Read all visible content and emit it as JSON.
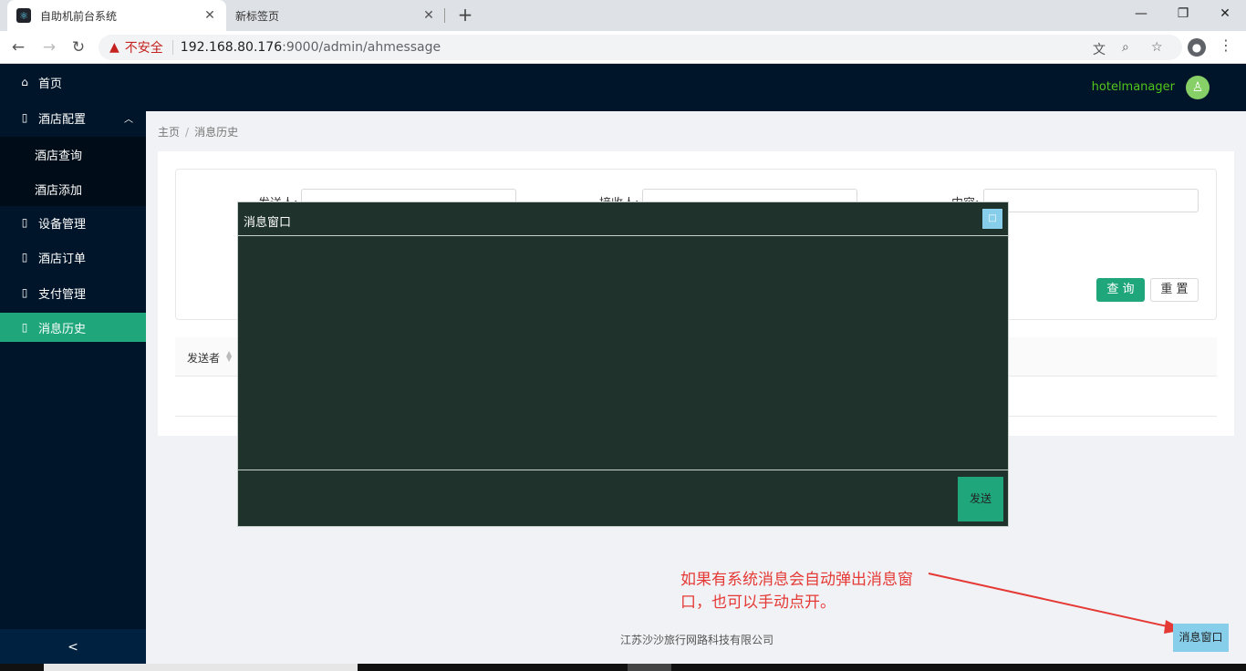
{
  "browser": {
    "tabs": [
      {
        "title": "自助机前台系统",
        "favicon": "react-logo-icon"
      },
      {
        "title": "新标签页"
      }
    ],
    "address": {
      "security_label": "不安全",
      "host": "192.168.80.176",
      "rest": ":9000/admin/ahmessage"
    }
  },
  "sidebar": {
    "items": [
      {
        "label": "首页",
        "icon": "home-icon"
      },
      {
        "label": "酒店配置",
        "icon": "file-icon"
      },
      {
        "label": "酒店查询"
      },
      {
        "label": "酒店添加"
      },
      {
        "label": "设备管理",
        "icon": "file-icon"
      },
      {
        "label": "酒店订单",
        "icon": "file-icon"
      },
      {
        "label": "支付管理",
        "icon": "file-icon"
      },
      {
        "label": "消息历史",
        "icon": "file-icon"
      }
    ],
    "collapse": "<"
  },
  "header": {
    "username": "hotelmanager"
  },
  "breadcrumb": {
    "home": "主页",
    "separator": "/",
    "current": "消息历史"
  },
  "search": {
    "sender_label": "发送人:",
    "receiver_label": "接收人:",
    "content_label": "内容:",
    "query_button": "查 询",
    "reset_button": "重 置"
  },
  "table": {
    "columns": [
      "发送者"
    ]
  },
  "footer": {
    "company": "江苏沙沙旅行网路科技有限公司"
  },
  "message_window": {
    "title": "消息窗口",
    "send_button": "发送"
  },
  "annotation": {
    "text": "如果有系统消息会自动弹出消息窗口，也可以手动点开。"
  },
  "message_toggle": {
    "label": "消息窗口"
  },
  "colors": {
    "sidebar_bg": "#001529",
    "accent": "#1fa67a",
    "message_bg": "#1f332c",
    "toggle_bg": "#87ceeb",
    "annotation": "#e53935"
  }
}
